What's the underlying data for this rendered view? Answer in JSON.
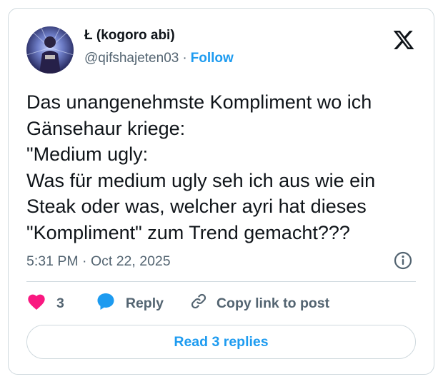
{
  "author": {
    "display_name": "Ł (kogoro abi)",
    "handle": "@qifshajeten03",
    "separator": "·",
    "follow_label": "Follow"
  },
  "tweet": {
    "text": "Das unangenehmste Kompliment wo ich\nGänsehaur kriege:\n\"Medium ugly:\nWas für medium ugly seh ich aus wie ein\nSteak oder was, welcher ayri hat dieses\n\"Kompliment\" zum Trend gemacht???",
    "timestamp": "5:31 PM · Oct 22, 2025"
  },
  "actions": {
    "like_count": "3",
    "reply_label": "Reply",
    "copy_link_label": "Copy link to post"
  },
  "read_replies_label": "Read 3 replies",
  "icons": {
    "brand": "x-logo-icon",
    "info": "info-icon",
    "like": "heart-icon",
    "reply": "speech-bubble-icon",
    "copy": "link-icon"
  },
  "colors": {
    "accent": "#1d9bf0",
    "like": "#f91880",
    "text_primary": "#0f1419",
    "text_secondary": "#536471",
    "border": "#cfd9de"
  }
}
